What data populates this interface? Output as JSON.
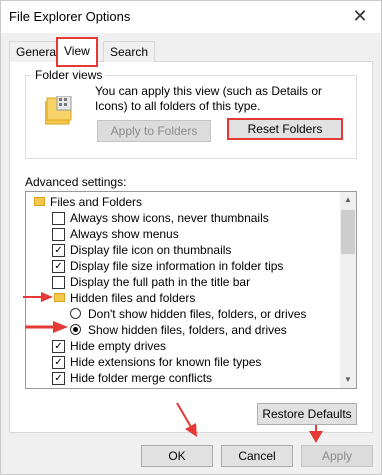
{
  "window": {
    "title": "File Explorer Options",
    "close_glyph": "✕"
  },
  "tabs": [
    {
      "label": "General"
    },
    {
      "label": "View"
    },
    {
      "label": "Search"
    }
  ],
  "folder_views": {
    "group_label": "Folder views",
    "description": "You can apply this view (such as Details or Icons) to all folders of this type.",
    "apply_label": "Apply to Folders",
    "reset_label": "Reset Folders"
  },
  "advanced": {
    "label": "Advanced settings:",
    "items": [
      {
        "type": "folder",
        "label": "Files and Folders"
      },
      {
        "type": "checkbox",
        "checked": false,
        "label": "Always show icons, never thumbnails"
      },
      {
        "type": "checkbox",
        "checked": false,
        "label": "Always show menus"
      },
      {
        "type": "checkbox",
        "checked": true,
        "label": "Display file icon on thumbnails"
      },
      {
        "type": "checkbox",
        "checked": true,
        "label": "Display file size information in folder tips"
      },
      {
        "type": "checkbox",
        "checked": false,
        "label": "Display the full path in the title bar"
      },
      {
        "type": "folder",
        "label": "Hidden files and folders"
      },
      {
        "type": "radio",
        "checked": false,
        "label": "Don't show hidden files, folders, or drives"
      },
      {
        "type": "radio",
        "checked": true,
        "label": "Show hidden files, folders, and drives"
      },
      {
        "type": "checkbox",
        "checked": true,
        "label": "Hide empty drives"
      },
      {
        "type": "checkbox",
        "checked": true,
        "label": "Hide extensions for known file types"
      },
      {
        "type": "checkbox",
        "checked": true,
        "label": "Hide folder merge conflicts"
      }
    ]
  },
  "restore_label": "Restore Defaults",
  "footer": {
    "ok_label": "OK",
    "cancel_label": "Cancel",
    "apply_label": "Apply"
  },
  "colors": {
    "highlight": "#e53935",
    "folder": "#f5c84c"
  }
}
